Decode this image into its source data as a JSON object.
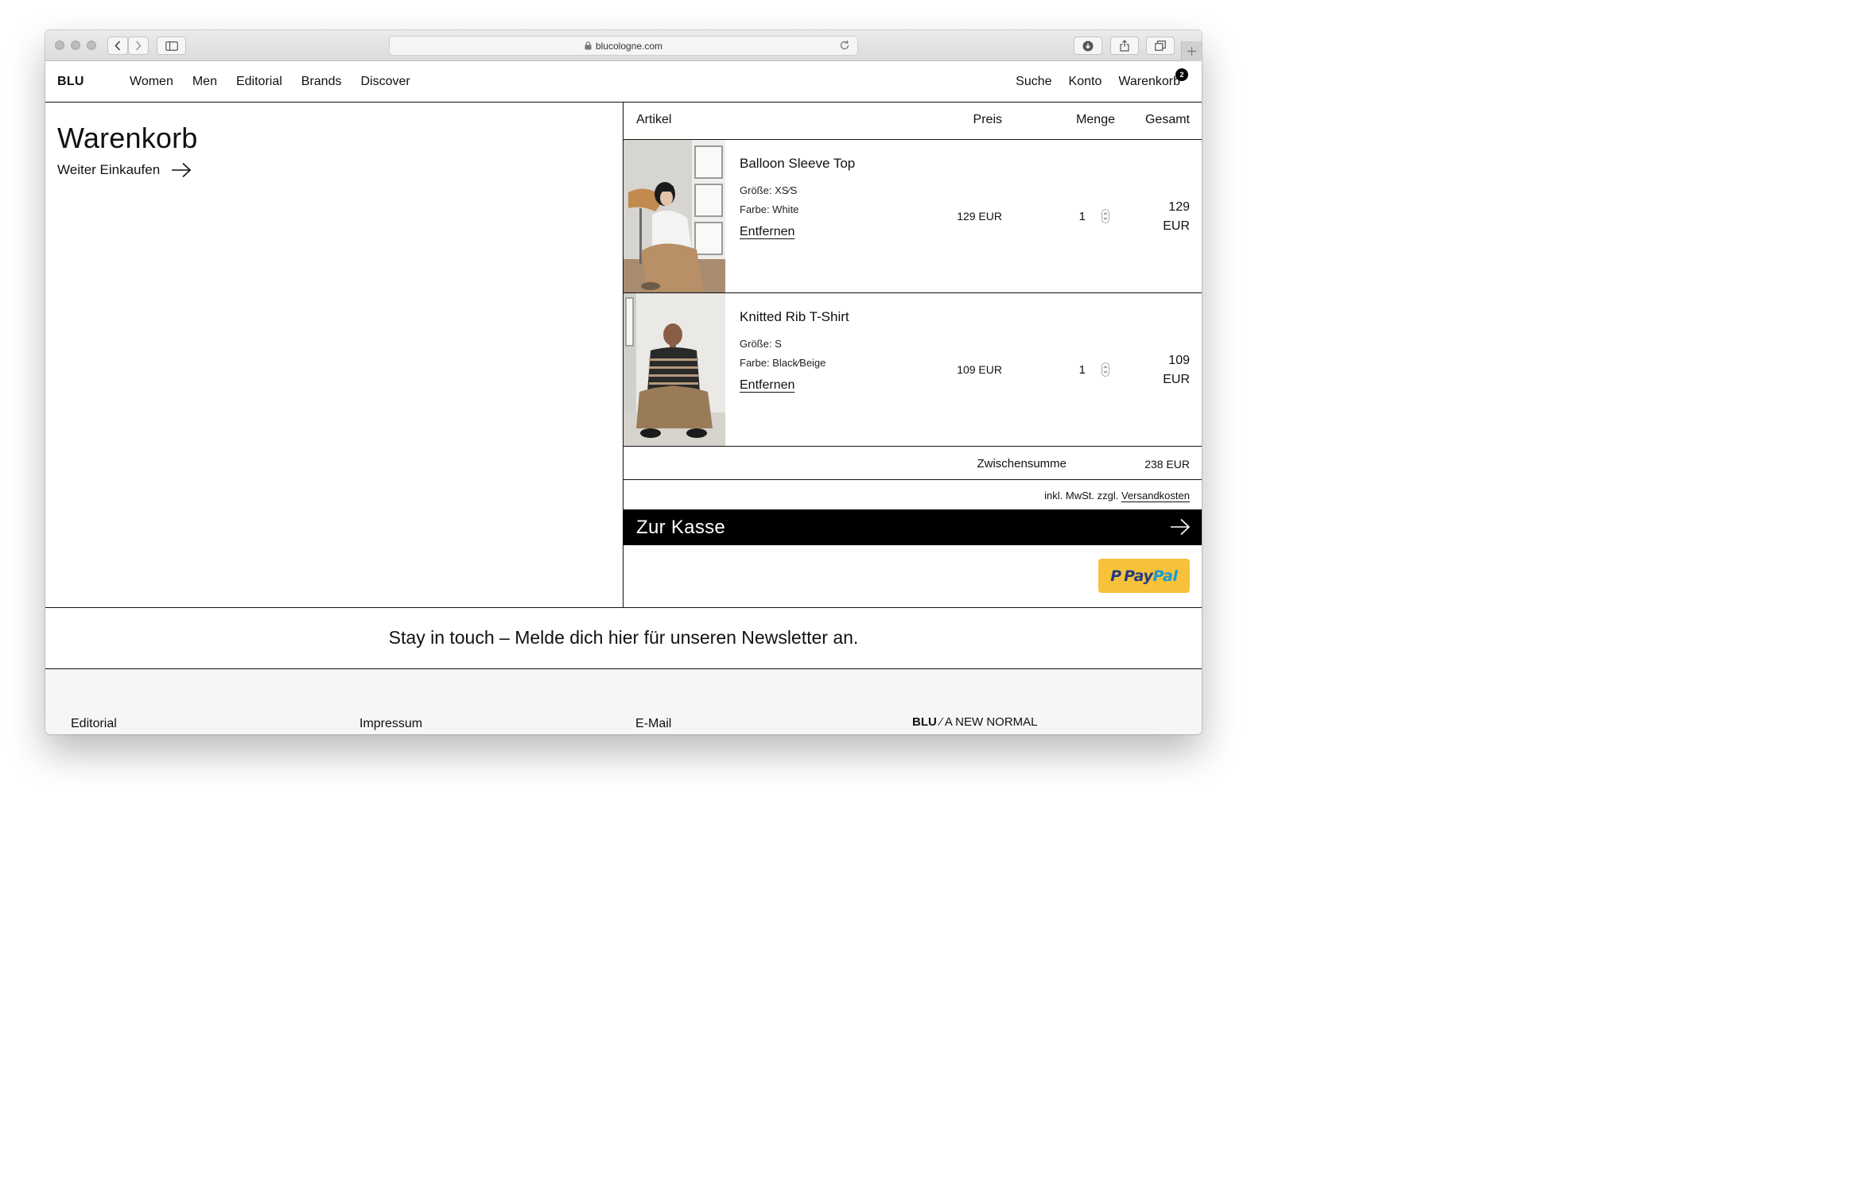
{
  "browser": {
    "url": "blucologne.com"
  },
  "header": {
    "logo": "BLU",
    "nav": [
      "Women",
      "Men",
      "Editorial",
      "Brands",
      "Discover"
    ],
    "utility": {
      "search": "Suche",
      "account": "Konto",
      "cart": "Warenkorb",
      "cart_count": "2"
    }
  },
  "cart": {
    "title": "Warenkorb",
    "continue_shopping": "Weiter Einkaufen",
    "columns": {
      "item": "Artikel",
      "price": "Preis",
      "quantity": "Menge",
      "total": "Gesamt"
    },
    "items": [
      {
        "name": "Balloon Sleeve Top",
        "size": "Größe: XS⁄S",
        "color": "Farbe: White",
        "remove": "Entfernen",
        "price": "129 EUR",
        "qty": "1",
        "total_amount": "129",
        "total_currency": "EUR"
      },
      {
        "name": "Knitted Rib T-Shirt",
        "size": "Größe: S",
        "color": "Farbe: Black⁄Beige",
        "remove": "Entfernen",
        "price": "109 EUR",
        "qty": "1",
        "total_amount": "109",
        "total_currency": "EUR"
      }
    ],
    "subtotal_label": "Zwischensumme",
    "subtotal_value": "238 EUR",
    "tax_note": "inkl. MwSt. zzgl.",
    "shipping_link": "Versandkosten",
    "checkout": "Zur Kasse",
    "paypal_pay": "Pay",
    "paypal_pal": "Pal"
  },
  "newsletter": "Stay in touch – Melde dich hier für unseren Newsletter an.",
  "footer": {
    "links": [
      "Editorial",
      "Impressum",
      "E-Mail"
    ],
    "brand": "BLU",
    "tagline": " ⁄ A NEW NORMAL"
  },
  "colors": {
    "accent": "#000000",
    "paypal_bg": "#f7c13a",
    "paypal_dark": "#253b80",
    "paypal_light": "#179bd7"
  }
}
